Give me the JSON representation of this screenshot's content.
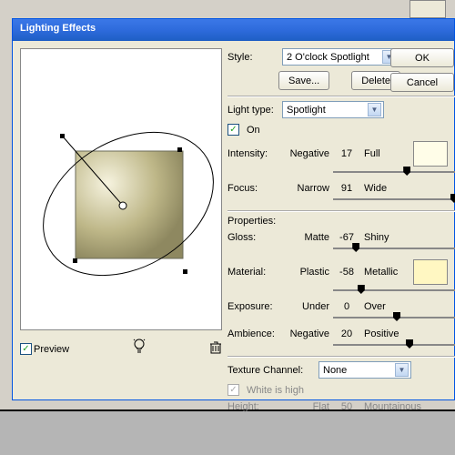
{
  "title": "Lighting Effects",
  "style": {
    "label": "Style:",
    "value": "2 O'clock Spotlight",
    "save": "Save...",
    "delete": "Delete"
  },
  "buttons": {
    "ok": "OK",
    "cancel": "Cancel"
  },
  "light": {
    "type_label": "Light type:",
    "type_value": "Spotlight",
    "on_label": "On",
    "on_checked": true
  },
  "sliders": {
    "intensity": {
      "label": "Intensity:",
      "left": "Negative",
      "value": "17",
      "right": "Full",
      "pos": 58
    },
    "focus": {
      "label": "Focus:",
      "left": "Narrow",
      "value": "91",
      "right": "Wide",
      "pos": 95
    }
  },
  "properties": {
    "heading": "Properties:",
    "gloss": {
      "label": "Gloss:",
      "left": "Matte",
      "value": "-67",
      "right": "Shiny",
      "pos": 18
    },
    "material": {
      "label": "Material:",
      "left": "Plastic",
      "value": "-58",
      "right": "Metallic",
      "pos": 22
    },
    "exposure": {
      "label": "Exposure:",
      "left": "Under",
      "value": "0",
      "right": "Over",
      "pos": 50
    },
    "ambience": {
      "label": "Ambience:",
      "left": "Negative",
      "value": "20",
      "right": "Positive",
      "pos": 60
    }
  },
  "texture": {
    "label": "Texture Channel:",
    "value": "None",
    "white_label": "White is high",
    "white_checked": true,
    "height_label": "Height:",
    "height_left": "Flat",
    "height_value": "50",
    "height_right": "Mountainous"
  },
  "preview": {
    "label": "Preview",
    "checked": true
  },
  "colors": {
    "light_swatch": "#fffde8",
    "material_swatch": "#fff7c2"
  }
}
